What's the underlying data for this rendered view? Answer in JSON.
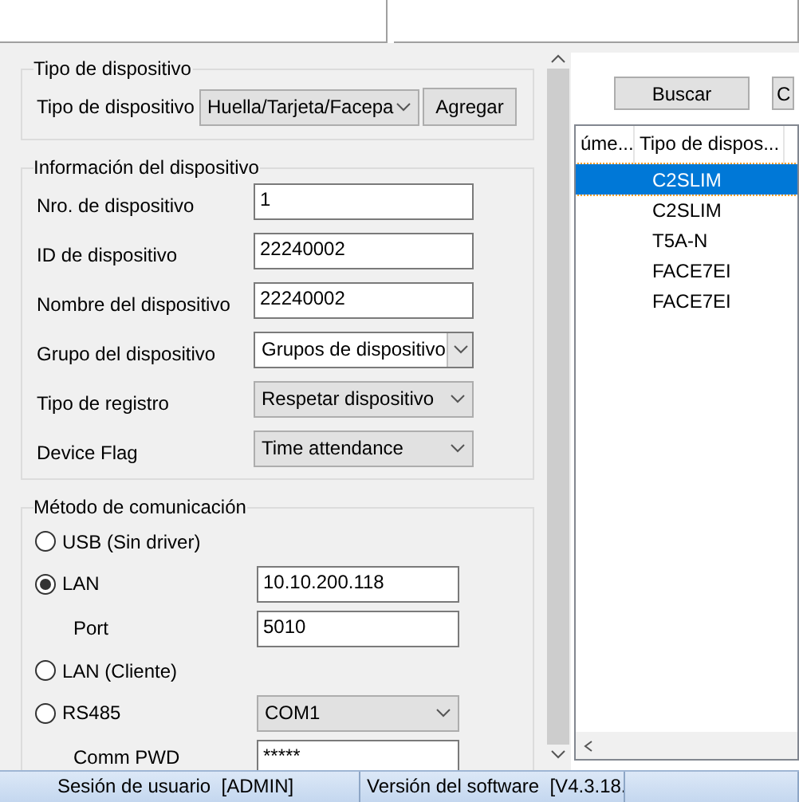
{
  "device_type": {
    "legend": "Tipo de dispositivo",
    "label": "Tipo de dispositivo",
    "value": "Huella/Tarjeta/Facepa",
    "button": "Agregar"
  },
  "device_info": {
    "legend": "Información del dispositivo",
    "fields": [
      {
        "label": "Nro. de dispositivo",
        "value": "1",
        "kind": "input"
      },
      {
        "label": "ID de dispositivo",
        "value": "22240002",
        "kind": "input"
      },
      {
        "label": "Nombre del dispositivo",
        "value": "22240002",
        "kind": "input"
      },
      {
        "label": "Grupo del dispositivo",
        "value": "Grupos de dispositivo",
        "kind": "combo"
      },
      {
        "label": "Tipo de registro",
        "value": "Respetar dispositivo",
        "kind": "select"
      },
      {
        "label": "Device Flag",
        "value": "Time attendance",
        "kind": "select"
      }
    ]
  },
  "communication": {
    "legend": "Método de comunicación",
    "items": [
      {
        "kind": "radio",
        "label": "USB (Sin driver)",
        "selected": false
      },
      {
        "kind": "radio",
        "label": "LAN",
        "selected": true,
        "field": {
          "kind": "input",
          "value": "10.10.200.118"
        }
      },
      {
        "kind": "sub",
        "label": "Port",
        "field": {
          "kind": "input",
          "value": "5010"
        }
      },
      {
        "kind": "radio",
        "label": "LAN (Cliente)",
        "selected": false
      },
      {
        "kind": "radio",
        "label": "RS485",
        "selected": false,
        "field": {
          "kind": "select",
          "value": "COM1"
        }
      },
      {
        "kind": "sub",
        "label": "Comm PWD",
        "field": {
          "kind": "input",
          "value": "*****"
        }
      }
    ]
  },
  "buttons": [
    "Buscar",
    "C"
  ],
  "device_list": {
    "columns": [
      "úme...",
      "Tipo de dispos..."
    ],
    "rows": [
      {
        "cells": [
          "",
          "C2SLIM"
        ],
        "selected": true
      },
      {
        "cells": [
          "",
          "C2SLIM"
        ],
        "selected": false
      },
      {
        "cells": [
          "",
          "T5A-N"
        ],
        "selected": false
      },
      {
        "cells": [
          "",
          "FACE7EI"
        ],
        "selected": false
      },
      {
        "cells": [
          "",
          "FACE7EI"
        ],
        "selected": false
      }
    ]
  },
  "status_bar": [
    "Sesión de usuario  [ADMIN]",
    "Versión del software  [V4.3.18."
  ]
}
